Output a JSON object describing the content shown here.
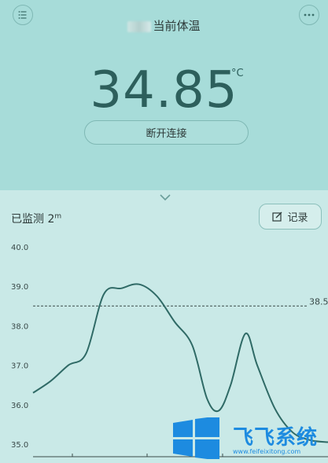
{
  "header": {
    "title": "当前体温",
    "menu_icon": "list-icon",
    "more_icon": "ellipsis-icon"
  },
  "reading": {
    "temperature": "34.85",
    "unit": "°C"
  },
  "actions": {
    "disconnect_label": "断开连接",
    "record_label": "记录"
  },
  "monitor": {
    "label": "已监测 2",
    "suffix": "m"
  },
  "chart_data": {
    "type": "line",
    "y_ticks": [
      "40.0",
      "39.0",
      "38.0",
      "37.0",
      "36.0",
      "35.0"
    ],
    "ylim": [
      35.0,
      40.0
    ],
    "threshold": {
      "value": 38.5,
      "label": "38.5"
    },
    "points": [
      {
        "x": 0,
        "y": 36.3
      },
      {
        "x": 6,
        "y": 36.6
      },
      {
        "x": 12,
        "y": 37.0
      },
      {
        "x": 18,
        "y": 37.3
      },
      {
        "x": 24,
        "y": 38.8
      },
      {
        "x": 30,
        "y": 38.95
      },
      {
        "x": 36,
        "y": 39.05
      },
      {
        "x": 42,
        "y": 38.75
      },
      {
        "x": 48,
        "y": 38.1
      },
      {
        "x": 54,
        "y": 37.5
      },
      {
        "x": 59,
        "y": 36.15
      },
      {
        "x": 63,
        "y": 35.85
      },
      {
        "x": 67,
        "y": 36.5
      },
      {
        "x": 72,
        "y": 37.8
      },
      {
        "x": 76,
        "y": 37.0
      },
      {
        "x": 82,
        "y": 35.9
      },
      {
        "x": 88,
        "y": 35.3
      },
      {
        "x": 94,
        "y": 35.1
      },
      {
        "x": 100,
        "y": 35.05
      }
    ],
    "grid": false
  },
  "watermark": {
    "brand": "飞飞系统",
    "url": "www.feifeixitong.com"
  },
  "colors": {
    "top_bg": "#a7dcd9",
    "bottom_bg": "#c9e9e7",
    "line": "#2f6a66",
    "text": "#2e3b3a",
    "brand": "#1d8be0"
  }
}
